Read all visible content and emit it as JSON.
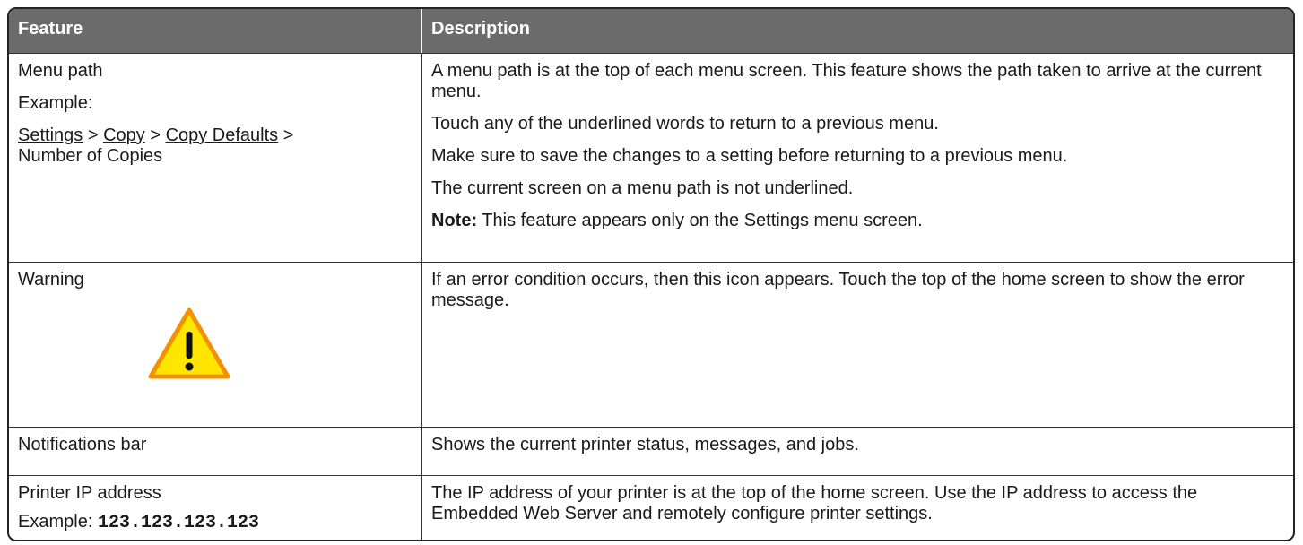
{
  "header": {
    "feature": "Feature",
    "description": "Description"
  },
  "rows": [
    {
      "feature": {
        "title": "Menu path",
        "example_label": "Example:",
        "path": {
          "item1": "Settings",
          "sep": " > ",
          "item2": "Copy",
          "item3": "Copy Defaults",
          "sep_end": " >",
          "item4": "Number of Copies"
        }
      },
      "description": {
        "p1": "A menu path is at the top of each menu screen. This feature shows the path taken to arrive at the current menu.",
        "p2": "Touch any of the underlined words to return to a previous menu.",
        "p3": "Make sure to save the changes to a setting before returning to a previous menu.",
        "p4": "The current screen on a menu path is not underlined.",
        "note_label": "Note:",
        "note_text": " This feature appears only on the Settings menu screen."
      }
    },
    {
      "feature": {
        "title": "Warning",
        "icon": "warning-icon"
      },
      "description": {
        "p1": "If an error condition occurs, then this icon appears. Touch the top of the home screen to show the error message."
      }
    },
    {
      "feature": {
        "title": "Notifications bar"
      },
      "description": {
        "p1": "Shows the current printer status, messages, and jobs."
      }
    },
    {
      "feature": {
        "title": "Printer IP address",
        "example_label": "Example: ",
        "example_value": "123.123.123.123"
      },
      "description": {
        "p1": "The IP address of your printer is at the top of the home screen. Use the IP address to access the Embedded Web Server and remotely configure printer settings."
      }
    }
  ],
  "colors": {
    "header_bg": "#6b6b6b",
    "warning_fill": "#ffe600",
    "warning_stroke": "#f39200"
  }
}
